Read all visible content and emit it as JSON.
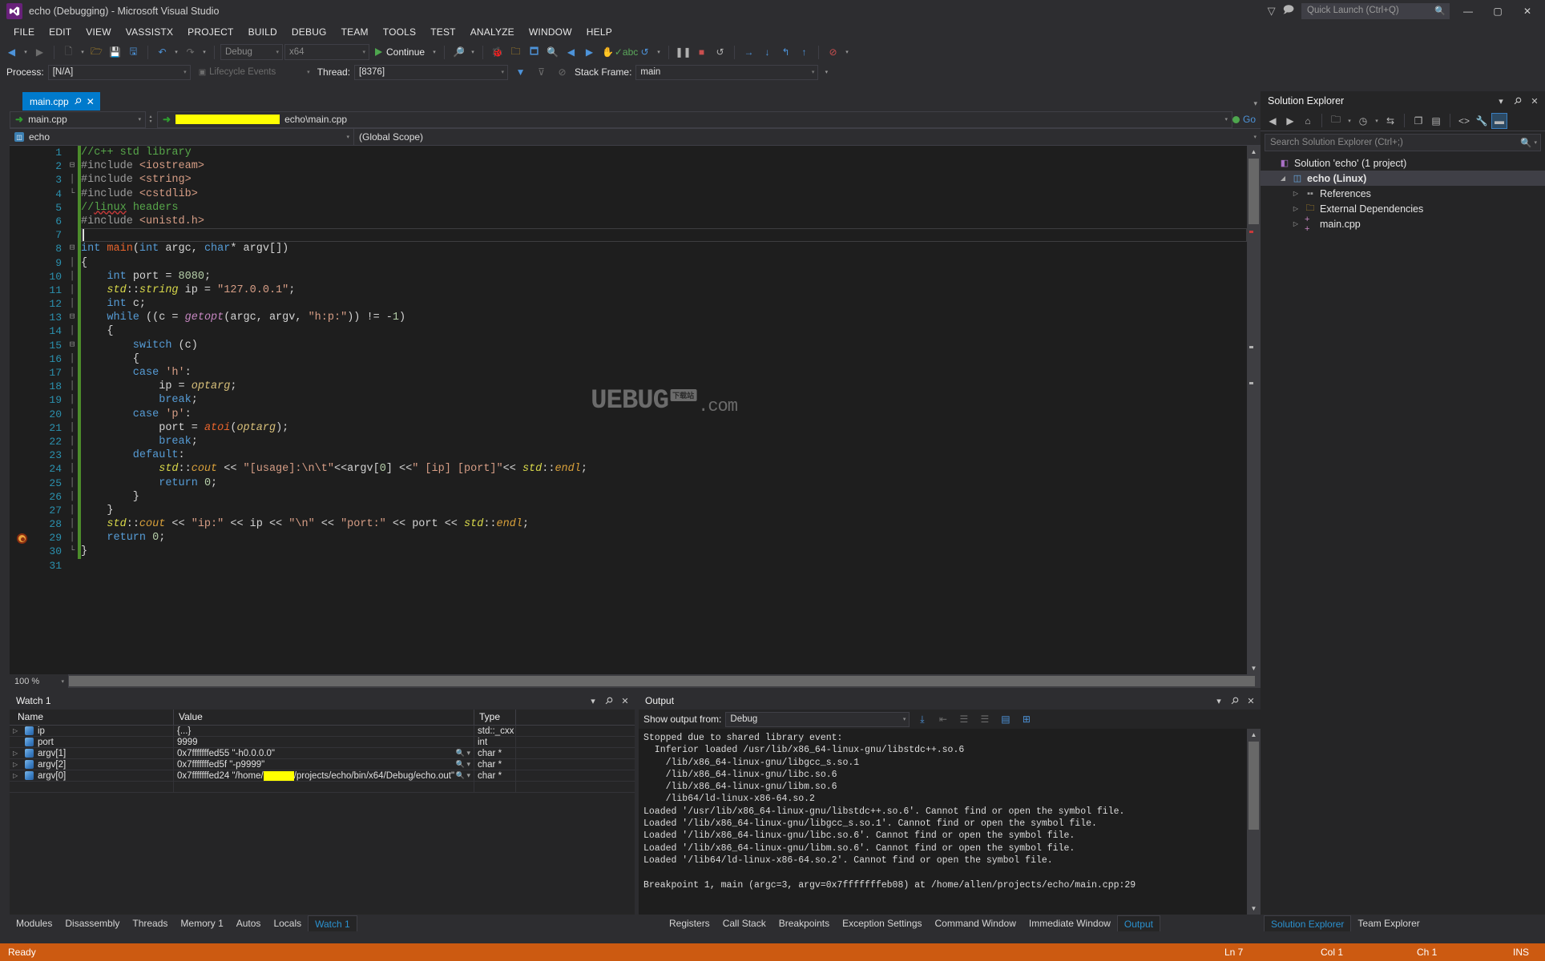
{
  "window": {
    "title": "echo (Debugging) - Microsoft Visual Studio",
    "logo_text": "▶◣",
    "minimize": "—",
    "maximize": "▢",
    "close": "✕",
    "filter_icon": "▽",
    "feedback_icon": "🗩"
  },
  "quick_launch": {
    "placeholder": "Quick Launch (Ctrl+Q)",
    "icon": "🔍"
  },
  "menu": {
    "items": [
      "FILE",
      "EDIT",
      "VIEW",
      "VASSISTX",
      "PROJECT",
      "BUILD",
      "DEBUG",
      "TEAM",
      "TOOLS",
      "TEST",
      "ANALYZE",
      "WINDOW",
      "HELP"
    ]
  },
  "toolbar": {
    "nav_back": "◀",
    "nav_forward": "▶",
    "new_item": "🗋",
    "open_file": "🗁",
    "save": "💾",
    "save_all": "🖫",
    "undo": "↶",
    "redo": "↷",
    "config": "Debug",
    "platform": "x64",
    "continue_label": "Continue",
    "find_icon": "🔎",
    "bug_icon": "🐞",
    "folder_icon": "🗀",
    "search_icon": "🔍",
    "prev_icon": "◀",
    "next_icon": "▶",
    "hand_icon": "✋",
    "abc_icon": "✓abc",
    "window_icon": "🗖",
    "pause_icon": "❚❚",
    "stop_icon": "■",
    "restart_icon": "↺",
    "step_over_icon": "→",
    "step_into_icon": "↓",
    "step_out_icon": "↰",
    "step_up_icon": "↑",
    "breakpoints_icon": "⊘"
  },
  "debug_bar": {
    "process_label": "Process:",
    "process_value": "[N/A]",
    "lifecycle_label": "Lifecycle Events",
    "thread_label": "Thread:",
    "thread_value": "[8376]",
    "stackframe_label": "Stack Frame:",
    "stackframe_value": "main",
    "filter_icon": "▼",
    "filter2_icon": "⊽",
    "nofilter_icon": "⊘"
  },
  "editor": {
    "tab_label": "main.cpp",
    "tab_pin": "📌",
    "tab_close": "✕",
    "nav_left_value": "main.cpp",
    "nav_path_suffix": "echo\\main.cpp",
    "nav_path_redacted": true,
    "go_label": "Go",
    "scope_left": "echo",
    "scope_right": "(Global Scope)",
    "zoom_level": "100 %",
    "line_count": 31,
    "breakpoint_line": 29,
    "cursor_line": 7,
    "lines": [
      {
        "n": 1,
        "fold": "",
        "tokens": [
          {
            "t": "//c++ std library",
            "c": "c-com"
          }
        ]
      },
      {
        "n": 2,
        "fold": "⊟",
        "tokens": [
          {
            "t": "#include ",
            "c": "c-pre"
          },
          {
            "t": "<iostream>",
            "c": "c-inc"
          }
        ]
      },
      {
        "n": 3,
        "fold": "│",
        "tokens": [
          {
            "t": "#include ",
            "c": "c-pre"
          },
          {
            "t": "<string>",
            "c": "c-inc"
          }
        ]
      },
      {
        "n": 4,
        "fold": "└",
        "tokens": [
          {
            "t": "#include ",
            "c": "c-pre"
          },
          {
            "t": "<cstdlib>",
            "c": "c-inc"
          }
        ]
      },
      {
        "n": 5,
        "fold": "",
        "tokens": [
          {
            "t": "//",
            "c": "c-com"
          },
          {
            "t": "linux",
            "c": "c-com squiggle"
          },
          {
            "t": " headers",
            "c": "c-com"
          }
        ]
      },
      {
        "n": 6,
        "fold": "",
        "tokens": [
          {
            "t": "#include ",
            "c": "c-pre"
          },
          {
            "t": "<unistd.h>",
            "c": "c-inc"
          }
        ]
      },
      {
        "n": 7,
        "fold": "",
        "tokens": []
      },
      {
        "n": 8,
        "fold": "⊟",
        "tokens": [
          {
            "t": "int ",
            "c": "c-key"
          },
          {
            "t": "main",
            "c": "c-main"
          },
          {
            "t": "(",
            "c": "c-id"
          },
          {
            "t": "int",
            "c": "c-key"
          },
          {
            "t": " argc, ",
            "c": "c-id"
          },
          {
            "t": "char",
            "c": "c-key"
          },
          {
            "t": "* argv[])",
            "c": "c-id"
          }
        ]
      },
      {
        "n": 9,
        "fold": "│",
        "tokens": [
          {
            "t": "{",
            "c": "c-id"
          }
        ]
      },
      {
        "n": 10,
        "fold": "│",
        "tokens": [
          {
            "t": "    int",
            "c": "c-key"
          },
          {
            "t": " port = ",
            "c": "c-id"
          },
          {
            "t": "8080",
            "c": "c-num"
          },
          {
            "t": ";",
            "c": "c-id"
          }
        ]
      },
      {
        "n": 11,
        "fold": "│",
        "tokens": [
          {
            "t": "    ",
            "c": "c-id"
          },
          {
            "t": "std",
            "c": "c-ns"
          },
          {
            "t": "::",
            "c": "c-id"
          },
          {
            "t": "string",
            "c": "c-ns"
          },
          {
            "t": " ip = ",
            "c": "c-id"
          },
          {
            "t": "\"127.0.0.1\"",
            "c": "c-str"
          },
          {
            "t": ";",
            "c": "c-id"
          }
        ]
      },
      {
        "n": 12,
        "fold": "│",
        "tokens": [
          {
            "t": "    int",
            "c": "c-key"
          },
          {
            "t": " c;",
            "c": "c-id"
          }
        ]
      },
      {
        "n": 13,
        "fold": "⊟",
        "tokens": [
          {
            "t": "    while",
            "c": "c-key"
          },
          {
            "t": " ((c = ",
            "c": "c-id"
          },
          {
            "t": "getopt",
            "c": "c-fn2"
          },
          {
            "t": "(argc, argv, ",
            "c": "c-id"
          },
          {
            "t": "\"h:p:\"",
            "c": "c-str"
          },
          {
            "t": ")) != -",
            "c": "c-id"
          },
          {
            "t": "1",
            "c": "c-num"
          },
          {
            "t": ")",
            "c": "c-id"
          }
        ]
      },
      {
        "n": 14,
        "fold": "│",
        "tokens": [
          {
            "t": "    {",
            "c": "c-id"
          }
        ]
      },
      {
        "n": 15,
        "fold": "⊟",
        "tokens": [
          {
            "t": "        switch",
            "c": "c-key"
          },
          {
            "t": " (c)",
            "c": "c-id"
          }
        ]
      },
      {
        "n": 16,
        "fold": "│",
        "tokens": [
          {
            "t": "        {",
            "c": "c-id"
          }
        ]
      },
      {
        "n": 17,
        "fold": "│",
        "tokens": [
          {
            "t": "        case ",
            "c": "c-key"
          },
          {
            "t": "'h'",
            "c": "c-str"
          },
          {
            "t": ":",
            "c": "c-id"
          }
        ]
      },
      {
        "n": 18,
        "fold": "│",
        "tokens": [
          {
            "t": "            ip = ",
            "c": "c-id"
          },
          {
            "t": "optarg",
            "c": "c-var"
          },
          {
            "t": ";",
            "c": "c-id"
          }
        ]
      },
      {
        "n": 19,
        "fold": "│",
        "tokens": [
          {
            "t": "            break",
            "c": "c-key"
          },
          {
            "t": ";",
            "c": "c-id"
          }
        ]
      },
      {
        "n": 20,
        "fold": "│",
        "tokens": [
          {
            "t": "        case ",
            "c": "c-key"
          },
          {
            "t": "'p'",
            "c": "c-str"
          },
          {
            "t": ":",
            "c": "c-id"
          }
        ]
      },
      {
        "n": 21,
        "fold": "│",
        "tokens": [
          {
            "t": "            port = ",
            "c": "c-id"
          },
          {
            "t": "atoi",
            "c": "c-fn3"
          },
          {
            "t": "(",
            "c": "c-id"
          },
          {
            "t": "optarg",
            "c": "c-var"
          },
          {
            "t": ");",
            "c": "c-id"
          }
        ]
      },
      {
        "n": 22,
        "fold": "│",
        "tokens": [
          {
            "t": "            break",
            "c": "c-key"
          },
          {
            "t": ";",
            "c": "c-id"
          }
        ]
      },
      {
        "n": 23,
        "fold": "│",
        "tokens": [
          {
            "t": "        default",
            "c": "c-key"
          },
          {
            "t": ":",
            "c": "c-id"
          }
        ]
      },
      {
        "n": 24,
        "fold": "│",
        "tokens": [
          {
            "t": "            ",
            "c": "c-id"
          },
          {
            "t": "std",
            "c": "c-ns"
          },
          {
            "t": "::",
            "c": "c-id"
          },
          {
            "t": "cout",
            "c": "c-mem"
          },
          {
            "t": " << ",
            "c": "c-id"
          },
          {
            "t": "\"[usage]:\\n\\t\"",
            "c": "c-str"
          },
          {
            "t": "<<argv[",
            "c": "c-id"
          },
          {
            "t": "0",
            "c": "c-num"
          },
          {
            "t": "] <<",
            "c": "c-id"
          },
          {
            "t": "\" [ip] [port]\"",
            "c": "c-str"
          },
          {
            "t": "<< ",
            "c": "c-id"
          },
          {
            "t": "std",
            "c": "c-ns"
          },
          {
            "t": "::",
            "c": "c-id"
          },
          {
            "t": "endl",
            "c": "c-mem"
          },
          {
            "t": ";",
            "c": "c-id"
          }
        ]
      },
      {
        "n": 25,
        "fold": "│",
        "tokens": [
          {
            "t": "            return ",
            "c": "c-key"
          },
          {
            "t": "0",
            "c": "c-num"
          },
          {
            "t": ";",
            "c": "c-id"
          }
        ]
      },
      {
        "n": 26,
        "fold": "│",
        "tokens": [
          {
            "t": "        }",
            "c": "c-id"
          }
        ]
      },
      {
        "n": 27,
        "fold": "│",
        "tokens": [
          {
            "t": "    }",
            "c": "c-id"
          }
        ]
      },
      {
        "n": 28,
        "fold": "│",
        "tokens": [
          {
            "t": "    ",
            "c": "c-id"
          },
          {
            "t": "std",
            "c": "c-ns"
          },
          {
            "t": "::",
            "c": "c-id"
          },
          {
            "t": "cout",
            "c": "c-mem"
          },
          {
            "t": " << ",
            "c": "c-id"
          },
          {
            "t": "\"ip:\"",
            "c": "c-str"
          },
          {
            "t": " << ip << ",
            "c": "c-id"
          },
          {
            "t": "\"\\n\"",
            "c": "c-str"
          },
          {
            "t": " << ",
            "c": "c-id"
          },
          {
            "t": "\"port:\"",
            "c": "c-str"
          },
          {
            "t": " << port << ",
            "c": "c-id"
          },
          {
            "t": "std",
            "c": "c-ns"
          },
          {
            "t": "::",
            "c": "c-id"
          },
          {
            "t": "endl",
            "c": "c-mem"
          },
          {
            "t": ";",
            "c": "c-id"
          }
        ]
      },
      {
        "n": 29,
        "fold": "│",
        "tokens": [
          {
            "t": "    return ",
            "c": "c-key"
          },
          {
            "t": "0",
            "c": "c-num"
          },
          {
            "t": ";",
            "c": "c-id"
          }
        ]
      },
      {
        "n": 30,
        "fold": "└",
        "tokens": [
          {
            "t": "}",
            "c": "c-id"
          }
        ]
      },
      {
        "n": 31,
        "fold": "",
        "tokens": []
      }
    ],
    "watermark": {
      "main": "UEBUG",
      "badge": "下载站",
      "suffix": ".com"
    }
  },
  "solution_explorer": {
    "title": "Solution Explorer",
    "dropdown_icon": "▾",
    "pin_icon": "📌",
    "close_icon": "✕",
    "search_placeholder": "Search Solution Explorer (Ctrl+;)",
    "search_icon": "🔍",
    "toolbar": [
      {
        "name": "back-icon",
        "glyph": "◀"
      },
      {
        "name": "forward-icon",
        "glyph": "▶"
      },
      {
        "name": "home-icon",
        "glyph": "⌂"
      },
      {
        "name": "new-folder-icon",
        "glyph": "🗀"
      },
      {
        "name": "pending-changes-icon",
        "glyph": "◷"
      },
      {
        "name": "sync-icon",
        "glyph": "⇆"
      },
      {
        "name": "refresh-icon",
        "glyph": "❐"
      },
      {
        "name": "collapse-all-icon",
        "glyph": "▤"
      },
      {
        "name": "show-all-files-icon",
        "glyph": "<>"
      },
      {
        "name": "properties-icon",
        "glyph": "🔧"
      },
      {
        "name": "preview-icon",
        "glyph": "▬"
      }
    ],
    "tree": [
      {
        "level": 0,
        "expander": "",
        "icon": "◧",
        "icon_color": "#a86fc4",
        "label": "Solution 'echo' (1 project)",
        "selected": false,
        "bold": false
      },
      {
        "level": 1,
        "expander": "◢",
        "icon": "◫",
        "icon_color": "#68a8e0",
        "label": "echo (Linux)",
        "selected": true,
        "bold": true
      },
      {
        "level": 2,
        "expander": "▷",
        "icon": "▪▪",
        "icon_color": "#9a9a9a",
        "label": "References",
        "selected": false,
        "bold": false
      },
      {
        "level": 2,
        "expander": "▷",
        "icon": "🗀",
        "icon_color": "#d8a429",
        "label": "External Dependencies",
        "selected": false,
        "bold": false
      },
      {
        "level": 2,
        "expander": "▷",
        "icon": "+ +",
        "icon_color": "#c586c0",
        "label": "main.cpp",
        "selected": false,
        "bold": false
      }
    ]
  },
  "watch": {
    "title": "Watch 1",
    "dropdown_icon": "▾",
    "pin_icon": "📌",
    "close_icon": "✕",
    "columns": [
      "Name",
      "Value",
      "Type"
    ],
    "rows": [
      {
        "expander": "▷",
        "name": "ip",
        "value": "{...}",
        "type": "std::_cxx",
        "redacted": false
      },
      {
        "expander": "",
        "name": "port",
        "value": "9999",
        "type": "int",
        "redacted": false
      },
      {
        "expander": "▷",
        "name": "argv[1]",
        "value": "0x7fffffffed55 \"-h0.0.0.0\"",
        "type": "char *",
        "redacted": false
      },
      {
        "expander": "▷",
        "name": "argv[2]",
        "value": "0x7fffffffed5f \"-p9999\"",
        "type": "char *",
        "redacted": false
      },
      {
        "expander": "▷",
        "name": "argv[0]",
        "value": "0x7fffffffed24 \"/home/",
        "value_suffix": "/projects/echo/bin/x64/Debug/echo.out\"",
        "type": "char *",
        "redacted": true
      }
    ],
    "magnifier_icon": "🔍"
  },
  "output": {
    "title": "Output",
    "dropdown_icon": "▾",
    "pin_icon": "📌",
    "close_icon": "✕",
    "show_output_label": "Show output from:",
    "source": "Debug",
    "toolbar_icons": [
      "⤓",
      "⇤",
      "☰",
      "☰",
      "▤",
      "⊞"
    ],
    "text": "Stopped due to shared library event:\n  Inferior loaded /usr/lib/x86_64-linux-gnu/libstdc++.so.6\n    /lib/x86_64-linux-gnu/libgcc_s.so.1\n    /lib/x86_64-linux-gnu/libc.so.6\n    /lib/x86_64-linux-gnu/libm.so.6\n    /lib64/ld-linux-x86-64.so.2\nLoaded '/usr/lib/x86_64-linux-gnu/libstdc++.so.6'. Cannot find or open the symbol file.\nLoaded '/lib/x86_64-linux-gnu/libgcc_s.so.1'. Cannot find or open the symbol file.\nLoaded '/lib/x86_64-linux-gnu/libc.so.6'. Cannot find or open the symbol file.\nLoaded '/lib/x86_64-linux-gnu/libm.so.6'. Cannot find or open the symbol file.\nLoaded '/lib64/ld-linux-x86-64.so.2'. Cannot find or open the symbol file.\n\nBreakpoint 1, main (argc=3, argv=0x7fffffffeb08) at /home/allen/projects/echo/main.cpp:29"
  },
  "bottom_tabs_left": [
    {
      "label": "Modules",
      "active": false
    },
    {
      "label": "Disassembly",
      "active": false
    },
    {
      "label": "Threads",
      "active": false
    },
    {
      "label": "Memory 1",
      "active": false
    },
    {
      "label": "Autos",
      "active": false
    },
    {
      "label": "Locals",
      "active": false
    },
    {
      "label": "Watch 1",
      "active": true
    }
  ],
  "bottom_tabs_right": [
    {
      "label": "Registers",
      "active": false
    },
    {
      "label": "Call Stack",
      "active": false
    },
    {
      "label": "Breakpoints",
      "active": false
    },
    {
      "label": "Exception Settings",
      "active": false
    },
    {
      "label": "Command Window",
      "active": false
    },
    {
      "label": "Immediate Window",
      "active": false
    },
    {
      "label": "Output",
      "active": true
    }
  ],
  "right_dock_tabs": [
    {
      "label": "Solution Explorer",
      "active": true
    },
    {
      "label": "Team Explorer",
      "active": false
    }
  ],
  "statusbar": {
    "message": "Ready",
    "line": "Ln 7",
    "col": "Col 1",
    "ch": "Ch 1",
    "insert_mode": "INS"
  },
  "colors": {
    "accent_blue": "#007acc",
    "status_orange": "#cc5a11",
    "chrome_dark": "#2d2d30",
    "editor_bg": "#1e1e1e",
    "panel_bg": "#252526",
    "redaction_yellow": "#ffff00"
  }
}
